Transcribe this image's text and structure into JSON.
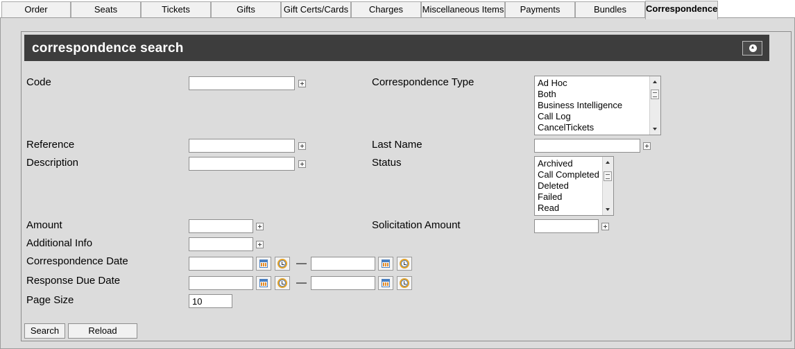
{
  "tabs": [
    {
      "label": "Order"
    },
    {
      "label": "Seats"
    },
    {
      "label": "Tickets"
    },
    {
      "label": "Gifts"
    },
    {
      "label": "Gift Certs/Cards"
    },
    {
      "label": "Charges"
    },
    {
      "label": "Miscellaneous Items"
    },
    {
      "label": "Payments"
    },
    {
      "label": "Bundles"
    },
    {
      "label": "Correspondence",
      "active": true
    }
  ],
  "panel": {
    "title": "correspondence search",
    "collapse_icon": "collapse-up-icon"
  },
  "form": {
    "code": {
      "label": "Code",
      "value": ""
    },
    "correspondence_type": {
      "label": "Correspondence Type",
      "options": [
        "Ad Hoc",
        "Both",
        "Business Intelligence",
        "Call Log",
        "CancelTickets"
      ]
    },
    "reference": {
      "label": "Reference",
      "value": ""
    },
    "last_name": {
      "label": "Last Name",
      "value": ""
    },
    "description": {
      "label": "Description",
      "value": ""
    },
    "status": {
      "label": "Status",
      "options": [
        "Archived",
        "Call Completed",
        "Deleted",
        "Failed",
        "Read"
      ]
    },
    "amount": {
      "label": "Amount",
      "value": ""
    },
    "solicitation_amount": {
      "label": "Solicitation Amount",
      "value": ""
    },
    "additional_info": {
      "label": "Additional Info",
      "value": ""
    },
    "correspondence_date": {
      "label": "Correspondence Date",
      "from": "",
      "to": "",
      "separator": "—"
    },
    "response_due_date": {
      "label": "Response Due Date",
      "from": "",
      "to": "",
      "separator": "—"
    },
    "page_size": {
      "label": "Page Size",
      "value": "10"
    }
  },
  "buttons": {
    "search": "Search",
    "reload": "Reload"
  },
  "icons": {
    "expand": "plus-icon",
    "calendar": "calendar-icon",
    "clock": "clock-icon"
  },
  "colors": {
    "header_bg": "#3d3d3d",
    "page_bg": "#dcdcdc"
  }
}
